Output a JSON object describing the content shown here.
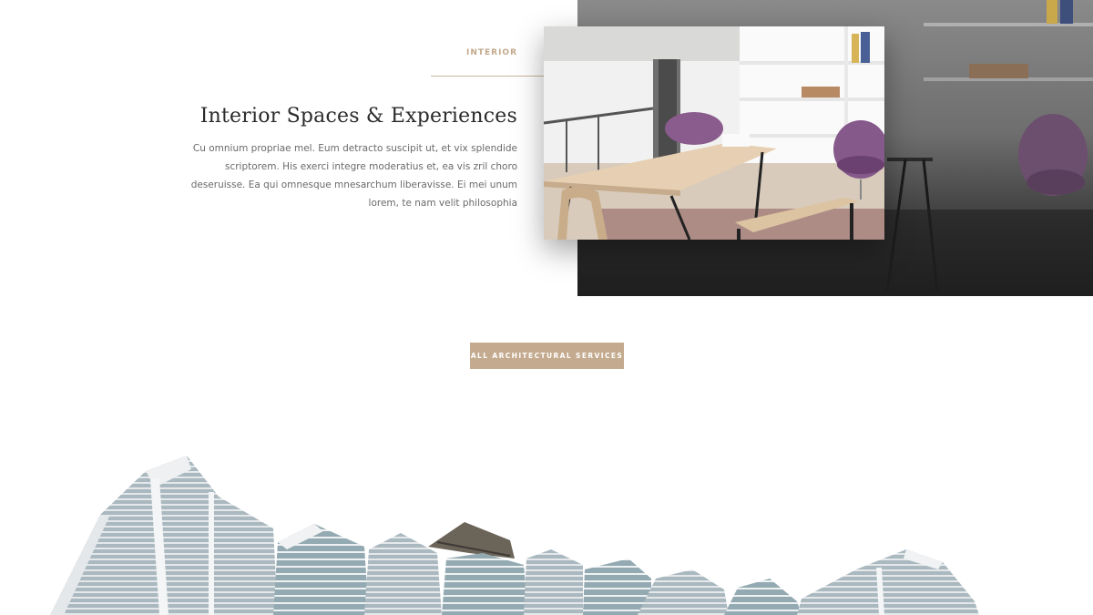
{
  "interior_section": {
    "eyebrow": "INTERIOR",
    "title": "Interior Spaces & Experiences",
    "body": "Cu omnium propriae mel. Eum detracto suscipit ut, et vix splendide scriptorem. His exerci integre moderatius et, ea vis zril choro deseruisse. Ea qui omnesque mnesarchum liberavisse. Ei mei unum lorem, te nam velit philosophia"
  },
  "cta": {
    "label": "ALL ARCHITECTURAL SERVICES"
  },
  "colors": {
    "accent": "#c4ab8f",
    "heading": "#2b2b2b",
    "body_text": "#6a6a6a"
  }
}
